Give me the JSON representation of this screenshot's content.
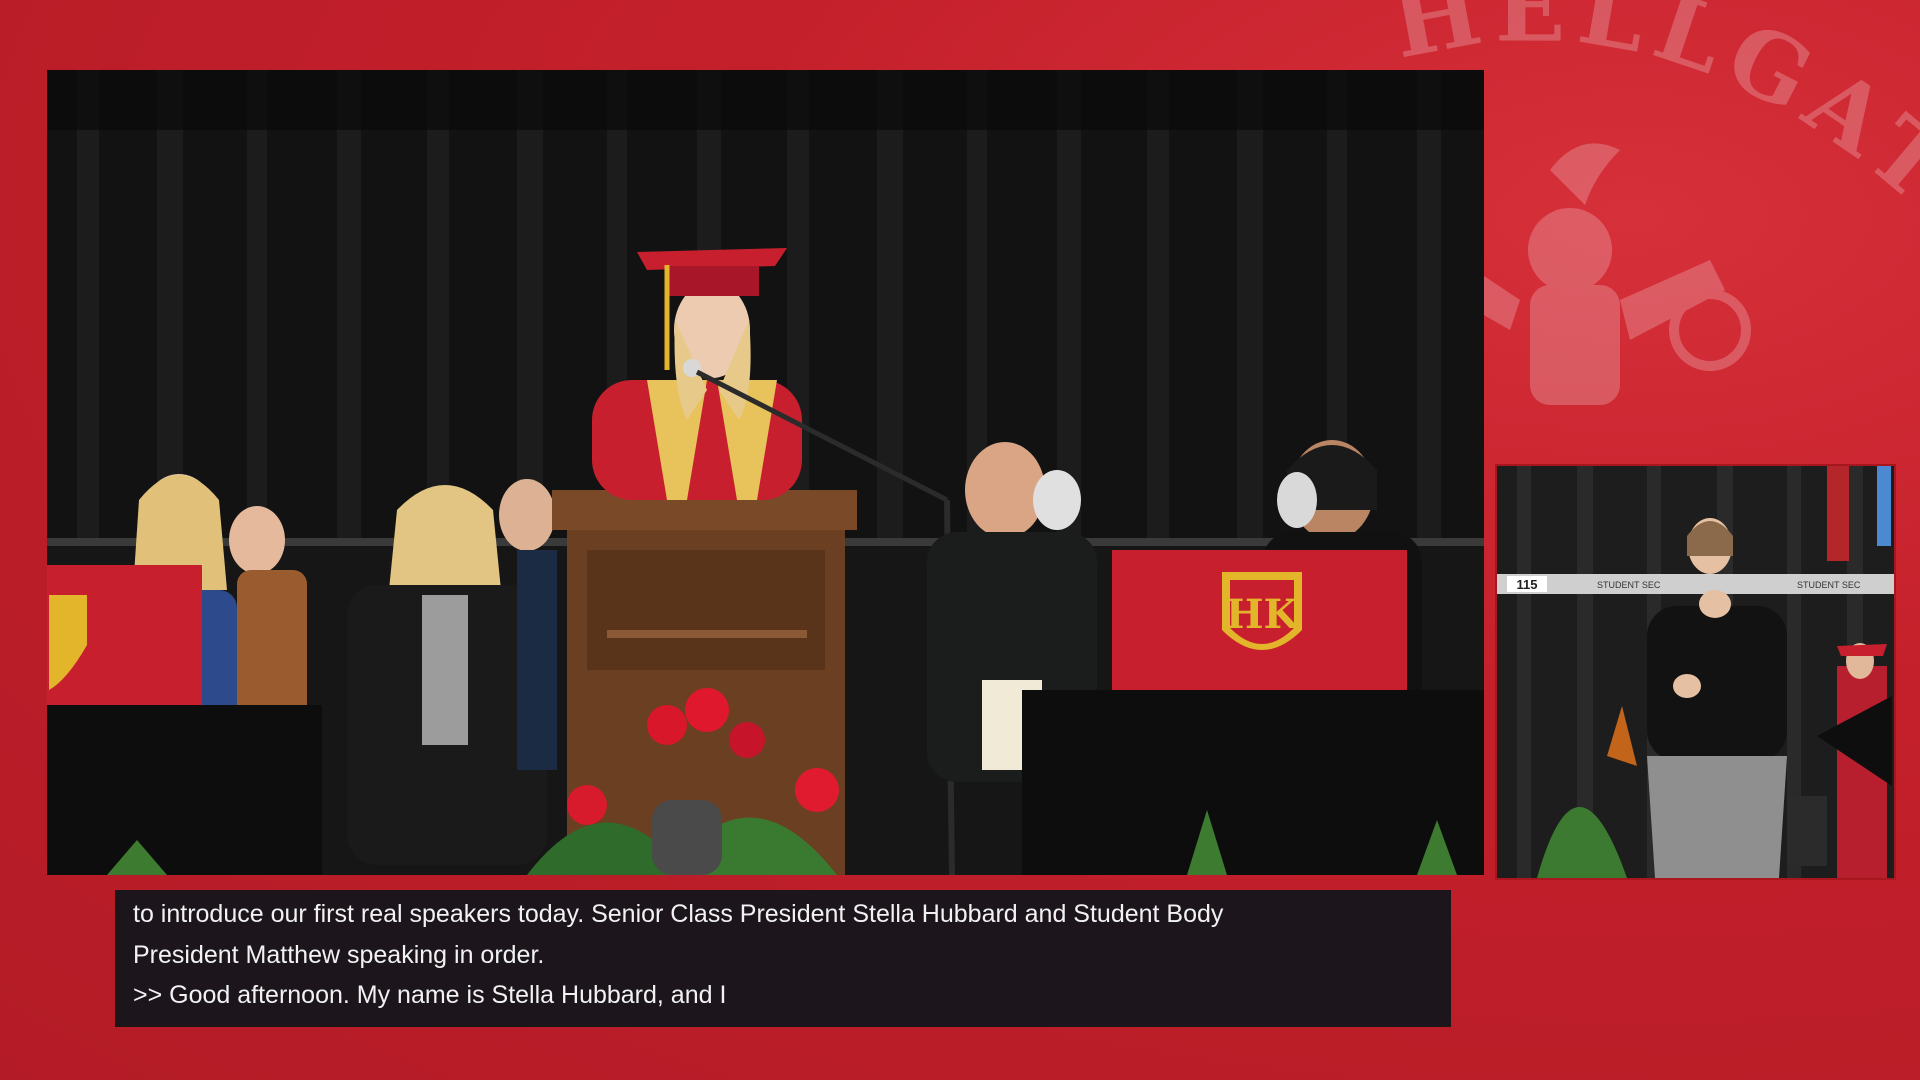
{
  "branding": {
    "watermark_text": "HELLGATE",
    "shield_monogram": "HK",
    "colors": {
      "background": "#c4202b",
      "gown_red": "#c81f2e",
      "shield_gold": "#e2b52a",
      "caption_bg": "#12161c"
    }
  },
  "inset": {
    "section_number": "115",
    "sign_left": "STUDENT SEC",
    "sign_right": "STUDENT SEC"
  },
  "captions": {
    "lines": [
      "to introduce our first real speakers today. Senior Class President Stella Hubbard and Student Body",
      "President Matthew speaking in order.",
      ">> Good afternoon. My name is Stella Hubbard, and I"
    ]
  }
}
